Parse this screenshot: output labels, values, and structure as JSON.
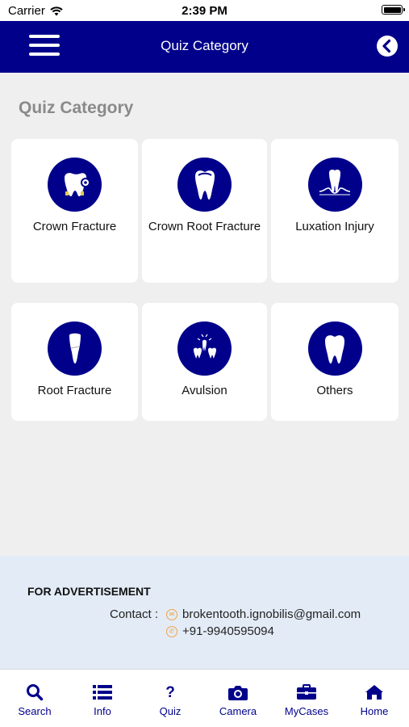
{
  "status_bar": {
    "carrier": "Carrier",
    "time": "2:39 PM"
  },
  "nav": {
    "title": "Quiz Category"
  },
  "page": {
    "heading": "Quiz Category"
  },
  "categories": [
    {
      "label": "Crown Fracture",
      "icon": "crown-fracture-tooth-icon"
    },
    {
      "label": "Crown Root Fracture",
      "icon": "crown-root-fracture-tooth-icon"
    },
    {
      "label": "Luxation Injury",
      "icon": "luxation-tooth-icon"
    },
    {
      "label": "Root Fracture",
      "icon": "root-fracture-tooth-icon"
    },
    {
      "label": "Avulsion",
      "icon": "avulsion-tooth-icon"
    },
    {
      "label": "Others",
      "icon": "tooth-icon"
    }
  ],
  "advertisement": {
    "title": "FOR ADVERTISEMENT",
    "contact_label": "Contact :",
    "email": "brokentooth.ignobilis@gmail.com",
    "phone": "+91-9940595094"
  },
  "tabs": [
    {
      "label": "Search",
      "icon": "search-icon"
    },
    {
      "label": "Info",
      "icon": "list-icon"
    },
    {
      "label": "Quiz",
      "icon": "question-icon"
    },
    {
      "label": "Camera",
      "icon": "camera-icon"
    },
    {
      "label": "MyCases",
      "icon": "briefcase-icon"
    },
    {
      "label": "Home",
      "icon": "home-icon"
    }
  ],
  "colors": {
    "primary": "#00008b",
    "background": "#efefef",
    "ad_background": "#e3ecf6",
    "accent_orange": "#f0a34a"
  }
}
